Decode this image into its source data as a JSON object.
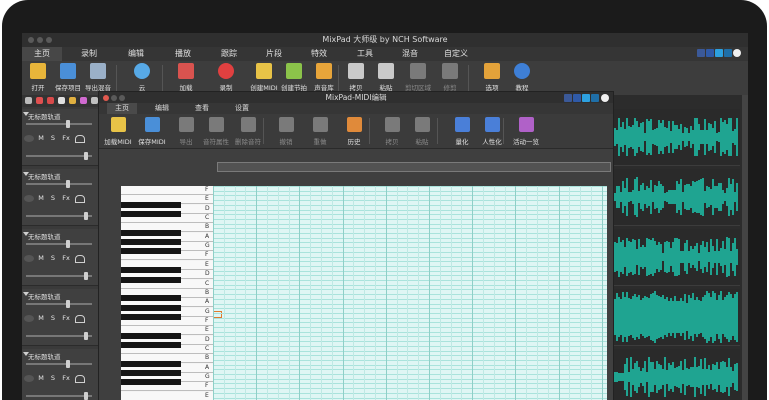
{
  "app": {
    "title": "MixPad 大师级 by NCH Software"
  },
  "menu": {
    "items": [
      "主页",
      "录制",
      "编辑",
      "播放",
      "跟踪",
      "片段",
      "特效",
      "工具",
      "混音",
      "自定义"
    ],
    "active": "主页"
  },
  "social": [
    "thumbs-up-icon",
    "facebook-icon",
    "twitter-icon",
    "linkedin-icon",
    "info-icon"
  ],
  "toolbar": {
    "buttons": [
      {
        "label": "打开",
        "icon": "folder-open-icon",
        "color": "#e8b53a"
      },
      {
        "label": "保存项目",
        "icon": "save-project-icon",
        "color": "#4a8fd8"
      },
      {
        "label": "导出混音",
        "icon": "export-mix-icon",
        "color": "#9ab0c8"
      },
      {
        "label": "云",
        "icon": "cloud-icon",
        "color": "#57a9e6"
      },
      {
        "label": "加载",
        "icon": "load-icon",
        "color": "#d9534f"
      },
      {
        "label": "录制",
        "icon": "record-icon",
        "color": "#e04040"
      },
      {
        "label": "创建MIDI",
        "icon": "create-midi-icon",
        "color": "#e8c347"
      },
      {
        "label": "创建节拍",
        "icon": "create-beat-icon",
        "color": "#8bc34a"
      },
      {
        "label": "声音库",
        "icon": "sound-library-icon",
        "color": "#e8a53a"
      },
      {
        "label": "拷贝",
        "icon": "copy-icon",
        "color": "#c9c9c9"
      },
      {
        "label": "粘贴",
        "icon": "paste-icon",
        "color": "#c9c9c9"
      },
      {
        "label": "剪切区域",
        "icon": "cut-region-icon",
        "color": "#7a7a7a"
      },
      {
        "label": "修剪",
        "icon": "trim-icon",
        "color": "#7a7a7a"
      },
      {
        "label": "选项",
        "icon": "options-icon",
        "color": "#e3a23a"
      },
      {
        "label": "教程",
        "icon": "tutorial-icon",
        "color": "#3e7fd6"
      }
    ]
  },
  "tracks": [
    {
      "name": "无标题轨道"
    },
    {
      "name": "无标题轨道"
    },
    {
      "name": "无标题轨道"
    },
    {
      "name": "无标题轨道"
    },
    {
      "name": "无标题轨道"
    }
  ],
  "track_buttons": {
    "mute": "M",
    "solo": "S",
    "fx": "Fx"
  },
  "midi": {
    "title": "MixPad-MIDI编辑",
    "tabs": [
      "主页",
      "编辑",
      "查看",
      "设置"
    ],
    "active_tab": "主页",
    "toolbar": [
      {
        "label": "加载MIDI",
        "icon": "load-midi-icon",
        "color": "#e8c347",
        "enabled": true
      },
      {
        "label": "保存MIDI",
        "icon": "save-midi-icon",
        "color": "#4a8fd8",
        "enabled": true
      },
      {
        "label": "导出",
        "icon": "export-icon",
        "color": "#7a7a7a",
        "enabled": false
      },
      {
        "label": "音符属性",
        "icon": "note-properties-icon",
        "color": "#7a7a7a",
        "enabled": false
      },
      {
        "label": "删除音符",
        "icon": "delete-note-icon",
        "color": "#7a7a7a",
        "enabled": false
      },
      {
        "label": "撤销",
        "icon": "undo-icon",
        "color": "#7a7a7a",
        "enabled": false
      },
      {
        "label": "重做",
        "icon": "redo-icon",
        "color": "#7a7a7a",
        "enabled": false
      },
      {
        "label": "历史",
        "icon": "history-icon",
        "color": "#e08a3a",
        "enabled": true
      },
      {
        "label": "拷贝",
        "icon": "copy-icon",
        "color": "#7a7a7a",
        "enabled": false
      },
      {
        "label": "粘贴",
        "icon": "paste-icon",
        "color": "#7a7a7a",
        "enabled": false
      },
      {
        "label": "量化",
        "icon": "quantize-icon",
        "color": "#4a7fd8",
        "enabled": true
      },
      {
        "label": "人性化",
        "icon": "humanize-icon",
        "color": "#4a7fd8",
        "enabled": true
      },
      {
        "label": "活动一览",
        "icon": "activity-overview-icon",
        "color": "#b061c8",
        "enabled": true
      }
    ],
    "key_labels": [
      "F",
      "E",
      "D",
      "C",
      "B",
      "A",
      "G",
      "F",
      "E",
      "D",
      "C",
      "B",
      "A",
      "G",
      "F",
      "E",
      "D",
      "C",
      "B",
      "A",
      "G",
      "F",
      "E"
    ]
  }
}
